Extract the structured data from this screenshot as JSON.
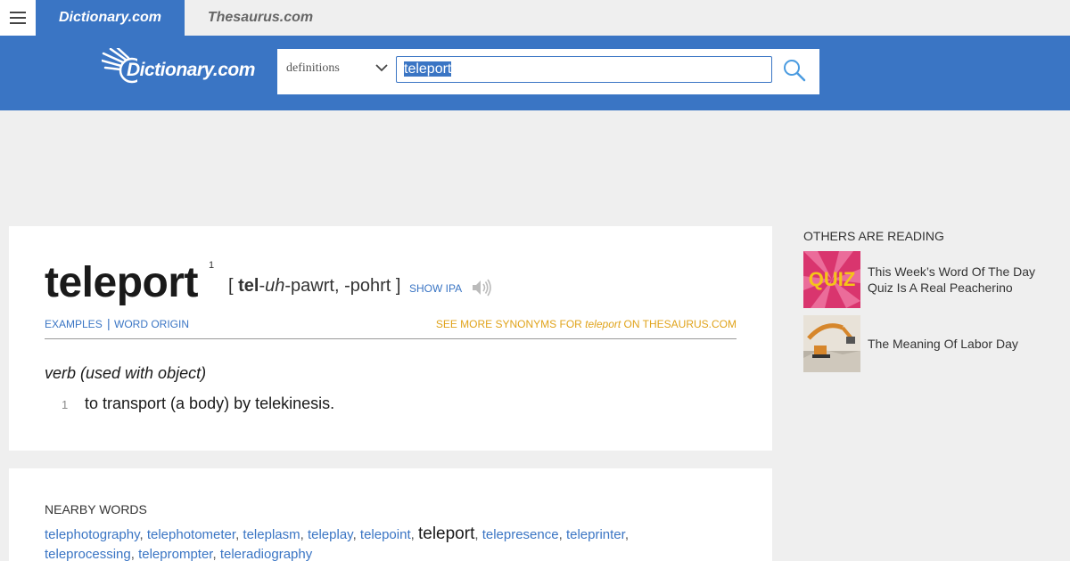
{
  "topbar": {
    "tabs": [
      {
        "label": "Dictionary.com",
        "active": true
      },
      {
        "label": "Thesaurus.com",
        "active": false
      }
    ]
  },
  "header": {
    "logo_text": "Dictionary.com",
    "search": {
      "scope": "definitions",
      "query": "teleport"
    }
  },
  "entry": {
    "headword": "teleport",
    "superscript": "1",
    "pron_open": "[ ",
    "pron_stress": "tel",
    "pron_sep": "-",
    "pron_italic": "uh",
    "pron_rest": "-pawrt, -pohrt ]",
    "show_ipa": "SHOW IPA",
    "links": {
      "examples": "EXAMPLES",
      "separator": "|",
      "word_origin": "WORD ORIGIN"
    },
    "synonyms": {
      "prefix": "SEE MORE SYNONYMS FOR ",
      "word": "teleport",
      "suffix": " ON THESAURUS.COM"
    },
    "part_of_speech": "verb (used with object)",
    "definitions": [
      {
        "number": "1",
        "text": "to transport (a body) by telekinesis."
      }
    ]
  },
  "nearby": {
    "title": "NEARBY WORDS",
    "words": [
      "telephotography",
      "telephotometer",
      "teleplasm",
      "teleplay",
      "telepoint",
      "teleport",
      "telepresence",
      "teleprinter",
      "teleprocessing",
      "teleprompter",
      "teleradiography"
    ],
    "current": "teleport"
  },
  "sidebar": {
    "title": "OTHERS ARE READING",
    "articles": [
      {
        "title": "This Week’s Word Of The Day Quiz Is A Real Peacherino",
        "thumb_text": "QUIZ"
      },
      {
        "title": "The Meaning Of Labor Day"
      }
    ]
  },
  "colors": {
    "brand_blue": "#3a75c4",
    "synonym_orange": "#e0a31a",
    "page_bg": "#efefef"
  }
}
